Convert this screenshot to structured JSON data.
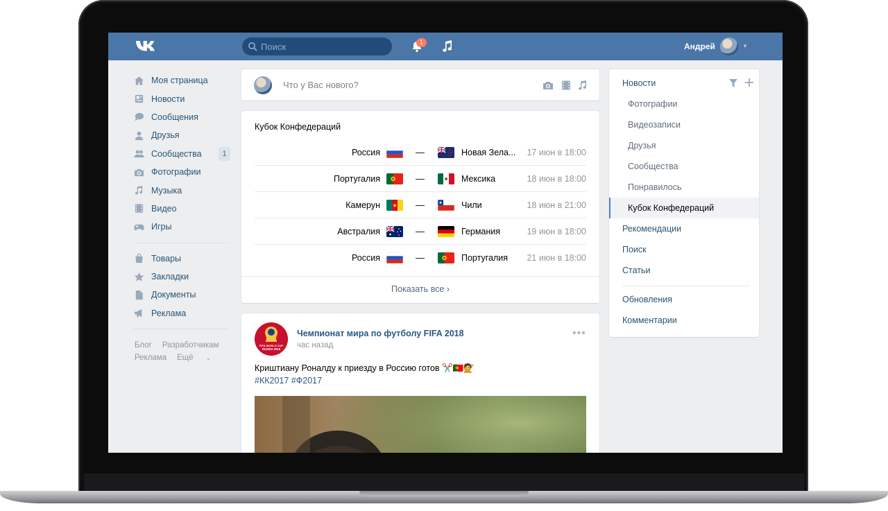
{
  "topbar": {
    "search_placeholder": "Поиск",
    "notifications_count": "1",
    "user_name": "Андрей"
  },
  "left_nav": {
    "items": [
      {
        "label": "Моя страница",
        "icon": "home-icon"
      },
      {
        "label": "Новости",
        "icon": "news-icon"
      },
      {
        "label": "Сообщения",
        "icon": "messages-icon"
      },
      {
        "label": "Друзья",
        "icon": "friends-icon"
      },
      {
        "label": "Сообщества",
        "icon": "groups-icon",
        "count": "1"
      },
      {
        "label": "Фотографии",
        "icon": "camera-icon"
      },
      {
        "label": "Музыка",
        "icon": "music-icon"
      },
      {
        "label": "Видео",
        "icon": "video-icon"
      },
      {
        "label": "Игры",
        "icon": "gamepad-icon"
      }
    ],
    "items2": [
      {
        "label": "Товары",
        "icon": "bag-icon"
      },
      {
        "label": "Закладки",
        "icon": "star-icon"
      },
      {
        "label": "Документы",
        "icon": "document-icon"
      },
      {
        "label": "Реклама",
        "icon": "megaphone-icon"
      }
    ],
    "footer": {
      "blog": "Блог",
      "developers": "Разработчикам",
      "ads": "Реклама",
      "more": "Ещё"
    }
  },
  "compose": {
    "placeholder": "Что у Вас нового?"
  },
  "cup": {
    "title": "Кубок Конфедераций",
    "matches": [
      {
        "home": "Россия",
        "away": "Новая Зела...",
        "date": "17 июн в 18:00",
        "flag_home": "russia",
        "flag_away": "new-zealand"
      },
      {
        "home": "Португалия",
        "away": "Мексика",
        "date": "18 июн в 18:00",
        "flag_home": "portugal",
        "flag_away": "mexico"
      },
      {
        "home": "Камерун",
        "away": "Чили",
        "date": "18 июн в 21:00",
        "flag_home": "cameroon",
        "flag_away": "chile"
      },
      {
        "home": "Австралия",
        "away": "Германия",
        "date": "19 июн в 18:00",
        "flag_home": "australia",
        "flag_away": "germany"
      },
      {
        "home": "Россия",
        "away": "Португалия",
        "date": "21 июн в 18:00",
        "flag_home": "russia",
        "flag_away": "portugal"
      }
    ],
    "dash": "—",
    "show_all": "Показать все ›"
  },
  "post": {
    "author": "Чемпионат мира по футболу FIFA 2018",
    "time": "час назад",
    "text": "Криштиану Роналду к приезду в Россию готов ✂️🇵🇹💇",
    "tags": "#КК2017 #Ф2017",
    "menu": "•••",
    "avatar_text": "FIFA WORLD CUP RUSSIA 2018"
  },
  "right_menu": {
    "news": "Новости",
    "photos": "Фотографии",
    "videos": "Видеозаписи",
    "friends": "Друзья",
    "groups": "Сообщества",
    "liked": "Понравилось",
    "cup": "Кубок Конфедераций",
    "recommendations": "Рекомендации",
    "search": "Поиск",
    "articles": "Статьи",
    "updates": "Обновления",
    "comments": "Комментарии"
  },
  "colors": {
    "header": "#4a76a8",
    "link": "#2a5885",
    "background": "#edeef0",
    "badge": "#ff7b5f"
  }
}
